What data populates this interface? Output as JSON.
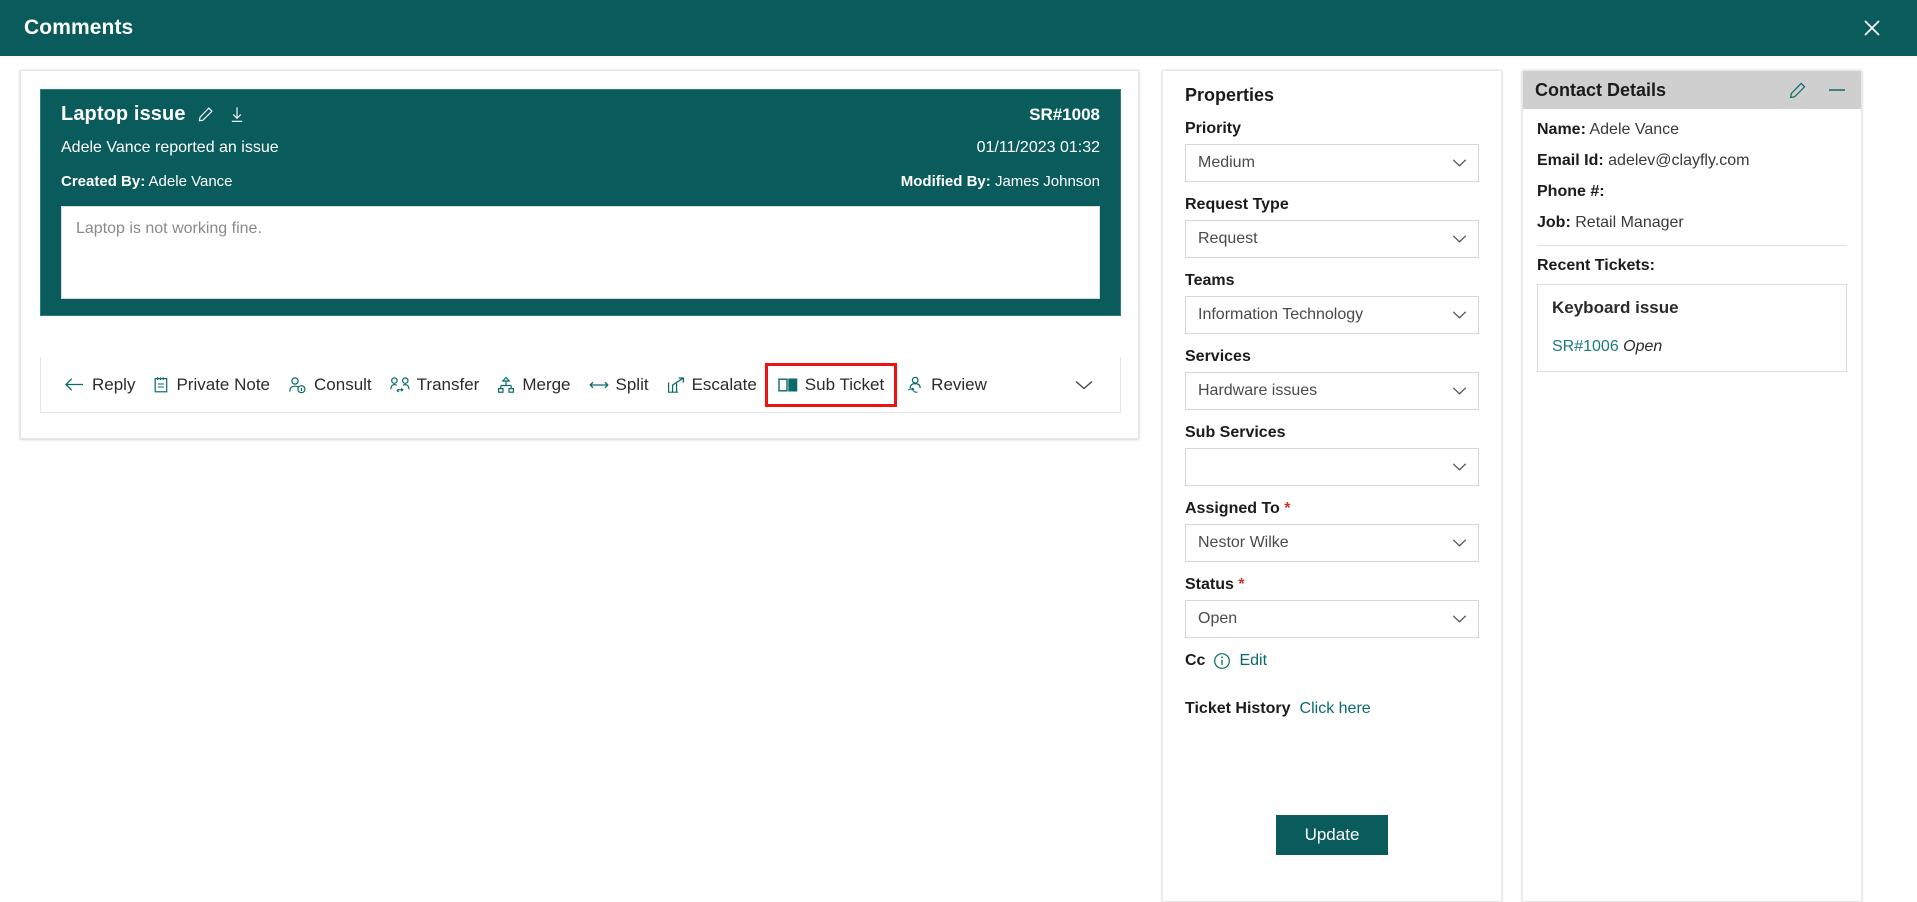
{
  "topbar": {
    "title": "Comments",
    "close_icon": "close-icon"
  },
  "ticket": {
    "title": "Laptop issue",
    "edit_icon": "pencil-icon",
    "download_icon": "download-icon",
    "sr_number": "SR#1008",
    "reported_line": "Adele Vance reported an issue",
    "datetime": "01/11/2023 01:32",
    "created_by_label": "Created By:",
    "created_by_value": "Adele Vance",
    "modified_by_label": "Modified By:",
    "modified_by_value": "James Johnson",
    "comment_text": "Laptop is not working fine."
  },
  "actions": [
    {
      "label": "Reply",
      "icon": "arrow-left-icon",
      "highlighted": false
    },
    {
      "label": "Private Note",
      "icon": "note-icon",
      "highlighted": false
    },
    {
      "label": "Consult",
      "icon": "person-info-icon",
      "highlighted": false
    },
    {
      "label": "Transfer",
      "icon": "people-swap-icon",
      "highlighted": false
    },
    {
      "label": "Merge",
      "icon": "merge-icon",
      "highlighted": false
    },
    {
      "label": "Split",
      "icon": "split-arrows-icon",
      "highlighted": false
    },
    {
      "label": "Escalate",
      "icon": "chart-arrow-up-icon",
      "highlighted": false
    },
    {
      "label": "Sub Ticket",
      "icon": "dual-panel-icon",
      "highlighted": true
    },
    {
      "label": "Review",
      "icon": "person-sync-icon",
      "highlighted": false
    }
  ],
  "actions_overflow_icon": "chevron-down-icon",
  "properties": {
    "title": "Properties",
    "fields": [
      {
        "label": "Priority",
        "value": "Medium",
        "required": false
      },
      {
        "label": "Request Type",
        "value": "Request",
        "required": false
      },
      {
        "label": "Teams",
        "value": "Information Technology",
        "required": false
      },
      {
        "label": "Services",
        "value": "Hardware issues",
        "required": false
      },
      {
        "label": "Sub Services",
        "value": "",
        "required": false
      },
      {
        "label": "Assigned To",
        "value": "Nestor Wilke",
        "required": true
      },
      {
        "label": "Status",
        "value": "Open",
        "required": true
      }
    ],
    "cc_label": "Cc",
    "cc_info_icon": "info-icon",
    "cc_edit_link": "Edit",
    "history_label": "Ticket History",
    "history_link": "Click here",
    "update_button": "Update"
  },
  "contact": {
    "title": "Contact Details",
    "edit_icon": "pencil-icon",
    "minimize_icon": "minimize-icon",
    "name_label": "Name:",
    "name_value": "Adele Vance",
    "email_label": "Email Id:",
    "email_value": "adelev@clayfly.com",
    "phone_label": "Phone #:",
    "phone_value": "",
    "job_label": "Job:",
    "job_value": "Retail Manager",
    "recent_title": "Recent Tickets:",
    "recent_tickets": [
      {
        "title": "Keyboard issue",
        "id": "SR#1006",
        "status": "Open"
      }
    ]
  },
  "colors": {
    "brand_teal": "#0a5c5c",
    "accent_teal": "#0a6a6a",
    "highlight_red": "#ee1111",
    "required_red": "#c0392b"
  }
}
